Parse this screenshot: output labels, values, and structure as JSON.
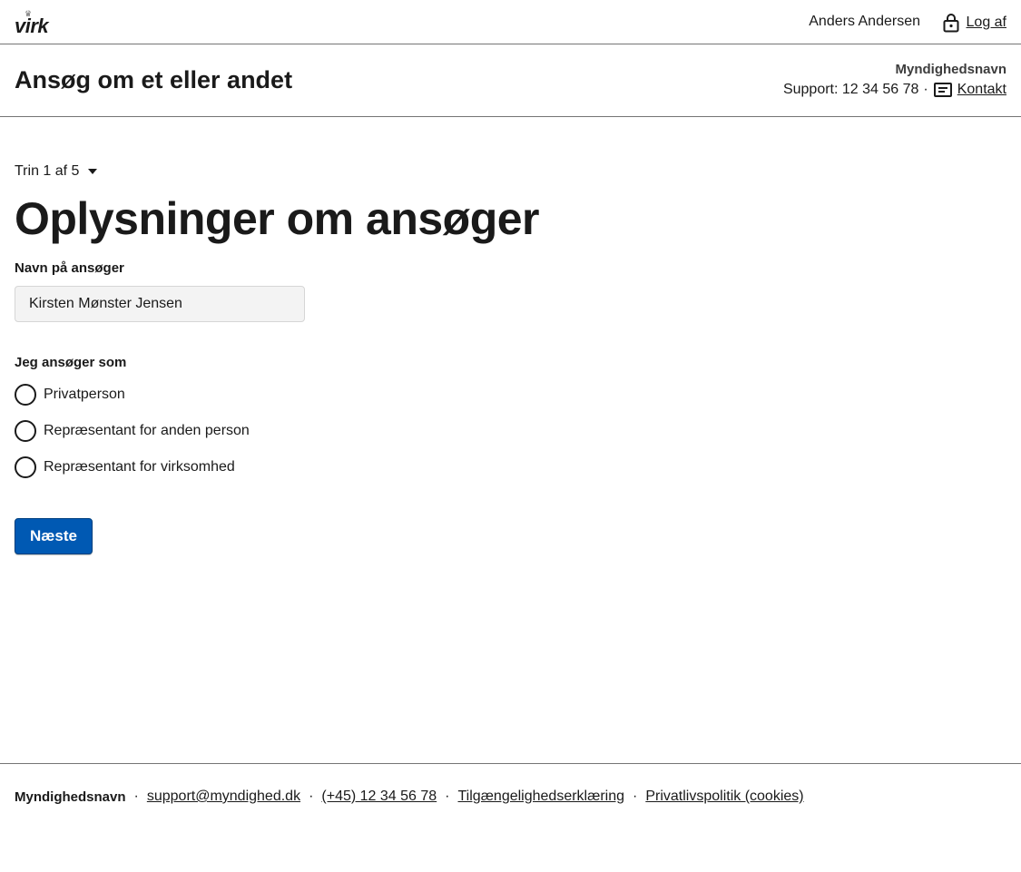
{
  "topbar": {
    "logo_text": "virk",
    "user_name": "Anders Andersen",
    "logout_label": "Log af"
  },
  "header": {
    "app_title": "Ansøg om et eller andet",
    "authority_name": "Myndighedsnavn",
    "support_text": "Support: 12 34 56 78",
    "separator": "·",
    "contact_label": "Kontakt"
  },
  "main": {
    "step_indicator": "Trin 1 af 5",
    "page_title": "Oplysninger om ansøger",
    "name_field": {
      "label": "Navn på ansøger",
      "value": "Kirsten Mønster Jensen"
    },
    "applicant_type": {
      "label": "Jeg ansøger som",
      "options": [
        {
          "label": "Privatperson",
          "selected": false
        },
        {
          "label": "Repræsentant for anden person",
          "selected": false
        },
        {
          "label": "Repræsentant for virksomhed",
          "selected": false
        }
      ]
    },
    "next_label": "Næste"
  },
  "footer": {
    "authority_name": "Myndighedsnavn",
    "separator": "·",
    "links": [
      "support@myndighed.dk",
      "(+45) 12 34 56 78",
      "Tilgængelighedserklæring",
      "Privatlivspolitik (cookies)"
    ]
  },
  "colors": {
    "primary_button": "#0059b3",
    "text": "#1a1a1a",
    "border": "#747474",
    "input_background": "#f3f3f3"
  },
  "icons": {
    "logo": "virk-crown-logo",
    "logout": "lock-icon",
    "contact": "message-icon",
    "step_toggle": "caret-down-icon",
    "radio": "radio-unchecked-icon"
  }
}
